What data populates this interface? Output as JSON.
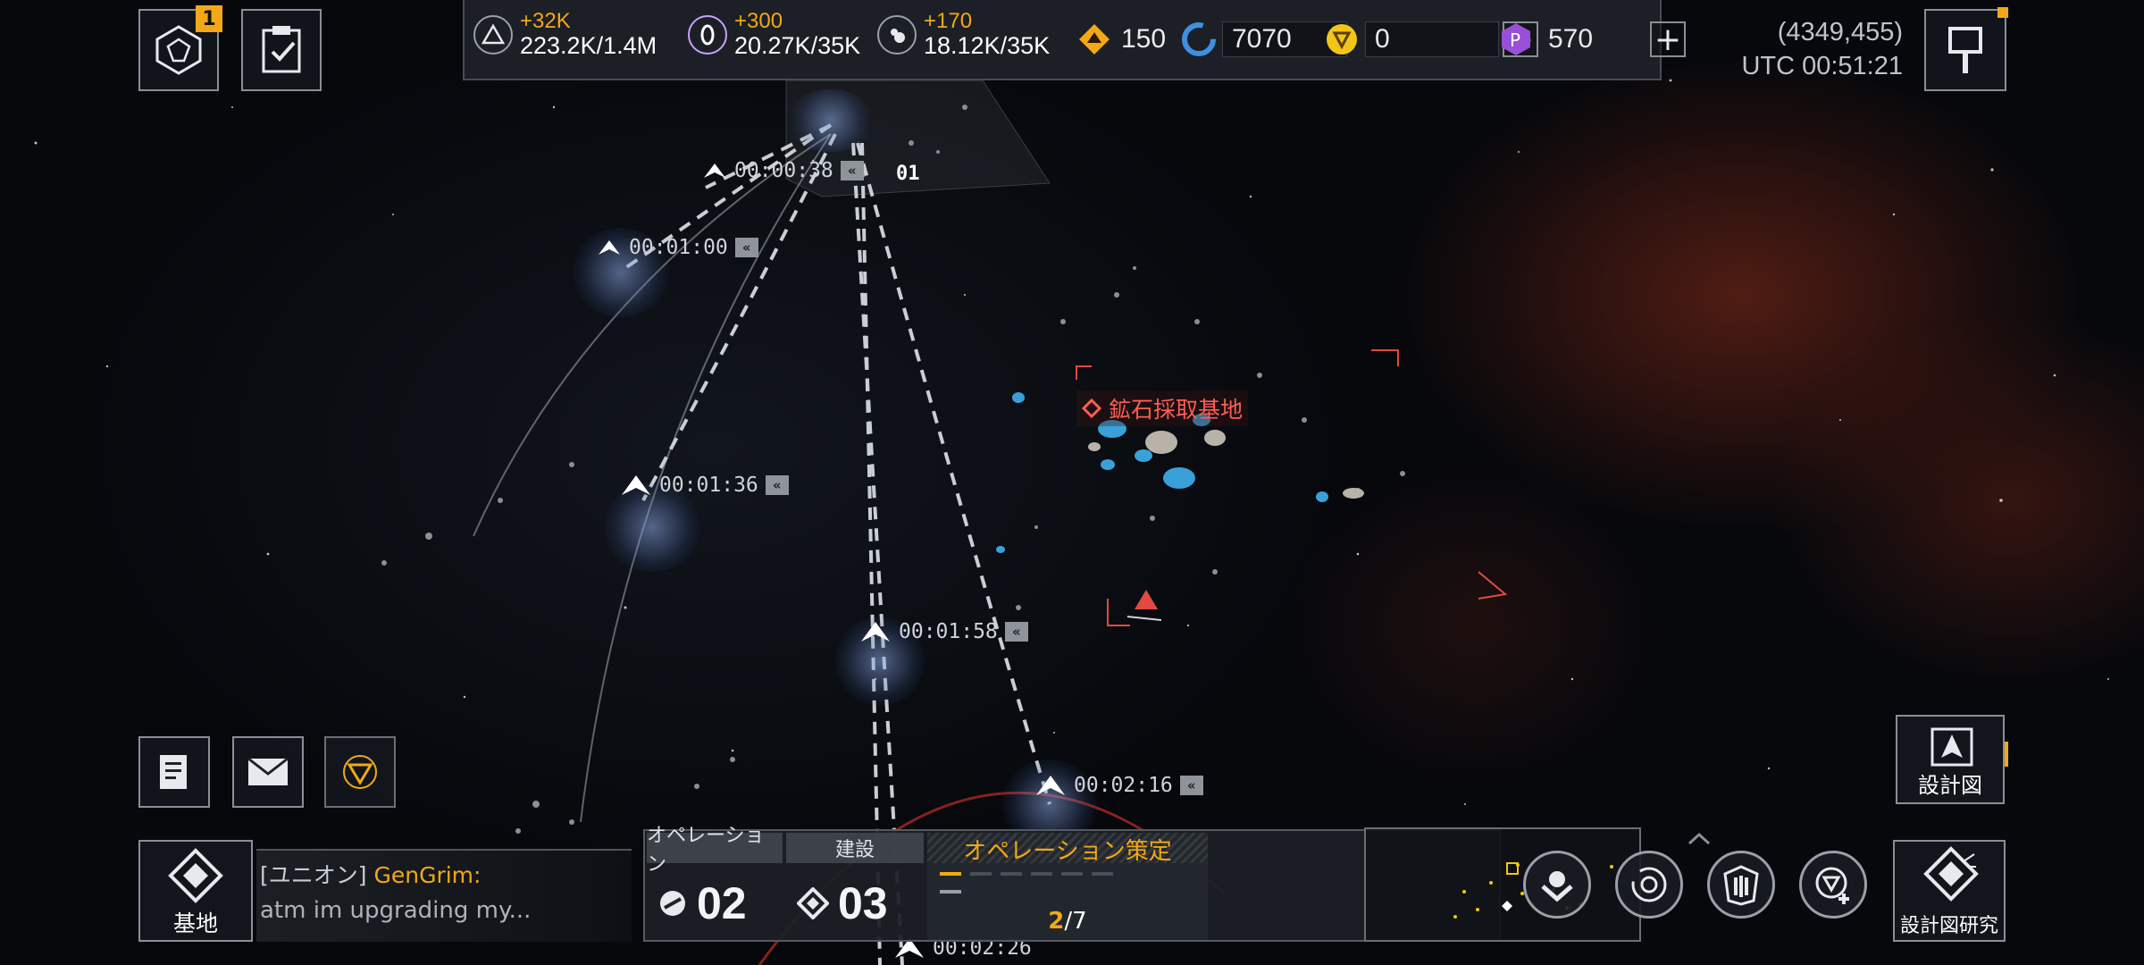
{
  "top_left": {
    "badge_count": "1"
  },
  "resources": [
    {
      "icon": "triangle-ore-icon",
      "delta": "+32K",
      "value": "223.2K/1.4M"
    },
    {
      "icon": "crystal-icon",
      "delta": "+300",
      "value": "20.27K/35K"
    },
    {
      "icon": "gas-icon",
      "delta": "+170",
      "value": "18.12K/35K"
    }
  ],
  "currencies": [
    {
      "icon": "orange-token-icon",
      "value": "150"
    },
    {
      "icon": "blue-cycle-icon",
      "value": "7070"
    },
    {
      "icon": "gold-coin-icon",
      "value": "0"
    },
    {
      "icon": "purple-gem-icon",
      "value": "570"
    }
  ],
  "coords": {
    "position": "(4349,455)",
    "time": "UTC 00:51:21"
  },
  "map": {
    "sector_label": "01",
    "target_label": "鉱石採取基地",
    "fleets": [
      {
        "time": "00:00:38"
      },
      {
        "time": "00:01:00"
      },
      {
        "time": "00:01:36"
      },
      {
        "time": "00:01:58"
      },
      {
        "time": "00:02:16"
      },
      {
        "time": "00:02:26"
      }
    ]
  },
  "blueprint": {
    "label": "設計図"
  },
  "bottom": {
    "base_label": "基地",
    "chat_channel": "[ユニオン]",
    "chat_name": "GenGrim:",
    "chat_message": "atm im upgrading  my...",
    "tabs": {
      "operation": "オペレーション",
      "build": "建設"
    },
    "operation_count": "02",
    "build_count": "03",
    "strategy_title": "オペレーション策定",
    "strategy_current": "2",
    "strategy_total": "/7",
    "research_label": "設計図研究"
  },
  "colors": {
    "accent": "#f2a817",
    "enemy": "#ff5d52",
    "panel": "#1e2228"
  }
}
